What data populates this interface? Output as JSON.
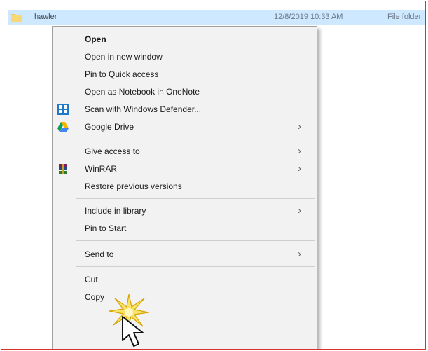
{
  "file": {
    "name": "hawler",
    "date": "12/8/2019 10:33 AM",
    "type": "File folder"
  },
  "menu": {
    "items": [
      {
        "label": "Open",
        "icon": ""
      },
      {
        "label": "Open in new window",
        "icon": ""
      },
      {
        "label": "Pin to Quick access",
        "icon": ""
      },
      {
        "label": "Open as Notebook in OneNote",
        "icon": ""
      },
      {
        "label": "Scan with Windows Defender...",
        "icon": "windows-defender-icon"
      },
      {
        "label": "Google Drive",
        "icon": "google-drive-icon",
        "submenu": true
      },
      {
        "label": "Give access to",
        "icon": "",
        "submenu": true
      },
      {
        "label": "WinRAR",
        "icon": "winrar-icon",
        "submenu": true
      },
      {
        "label": "Restore previous versions",
        "icon": ""
      },
      {
        "label": "Include in library",
        "icon": "",
        "submenu": true
      },
      {
        "label": "Pin to Start",
        "icon": ""
      },
      {
        "label": "Send to",
        "icon": "",
        "submenu": true
      },
      {
        "label": "Cut",
        "icon": ""
      },
      {
        "label": "Copy",
        "icon": ""
      }
    ],
    "submenu_arrow": "›"
  },
  "colors": {
    "selection": "#cde8ff",
    "menu_bg": "#f2f2f2",
    "frame_border": "#d9302c"
  }
}
